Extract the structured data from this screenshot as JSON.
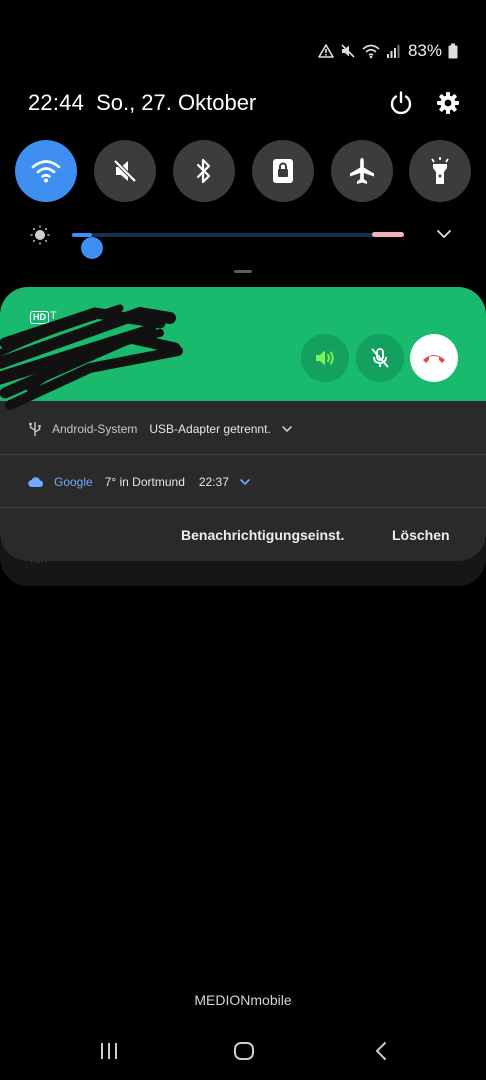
{
  "status": {
    "battery": "83%",
    "icons": [
      "alert-triangle-icon",
      "mute-icon",
      "wifi-icon",
      "signal-icon",
      "battery-icon"
    ]
  },
  "header": {
    "time": "22:44",
    "date": "So., 27. Oktober",
    "icons": [
      "power-icon",
      "gear-icon"
    ]
  },
  "quick_tiles": [
    {
      "name": "wifi",
      "icon": "wifi-icon",
      "active": true
    },
    {
      "name": "sound",
      "icon": "mute-icon",
      "active": false
    },
    {
      "name": "bluetooth",
      "icon": "bluetooth-icon",
      "active": false
    },
    {
      "name": "rotation-lock",
      "icon": "lock-icon",
      "active": false
    },
    {
      "name": "airplane-mode",
      "icon": "airplane-icon",
      "active": false
    },
    {
      "name": "flashlight",
      "icon": "flashlight-icon",
      "active": false
    }
  ],
  "brightness": {
    "level": 0.06
  },
  "call": {
    "badge": "HD",
    "caller_visible": "T",
    "buttons": [
      "speaker-icon",
      "mic-off-icon",
      "hangup-icon"
    ]
  },
  "notifications": [
    {
      "app": "Android-System",
      "text": "USB-Adapter getrennt.",
      "icon": "usb-icon"
    },
    {
      "app": "Google",
      "text": "7° in Dortmund",
      "time": "22:37",
      "icon": "cloud-icon",
      "accent": "#6fa8ff"
    }
  ],
  "actions": {
    "settings": "Benachrichtigungseinst.",
    "clear": "Löschen"
  },
  "hidden_notification_hint": "Ton",
  "carrier": "MEDIONmobile",
  "colors": {
    "accent": "#3f8ff3",
    "call_green": "#19ba6e",
    "hangup_red": "#e54b4b",
    "speaker_green": "#7ff25a"
  }
}
